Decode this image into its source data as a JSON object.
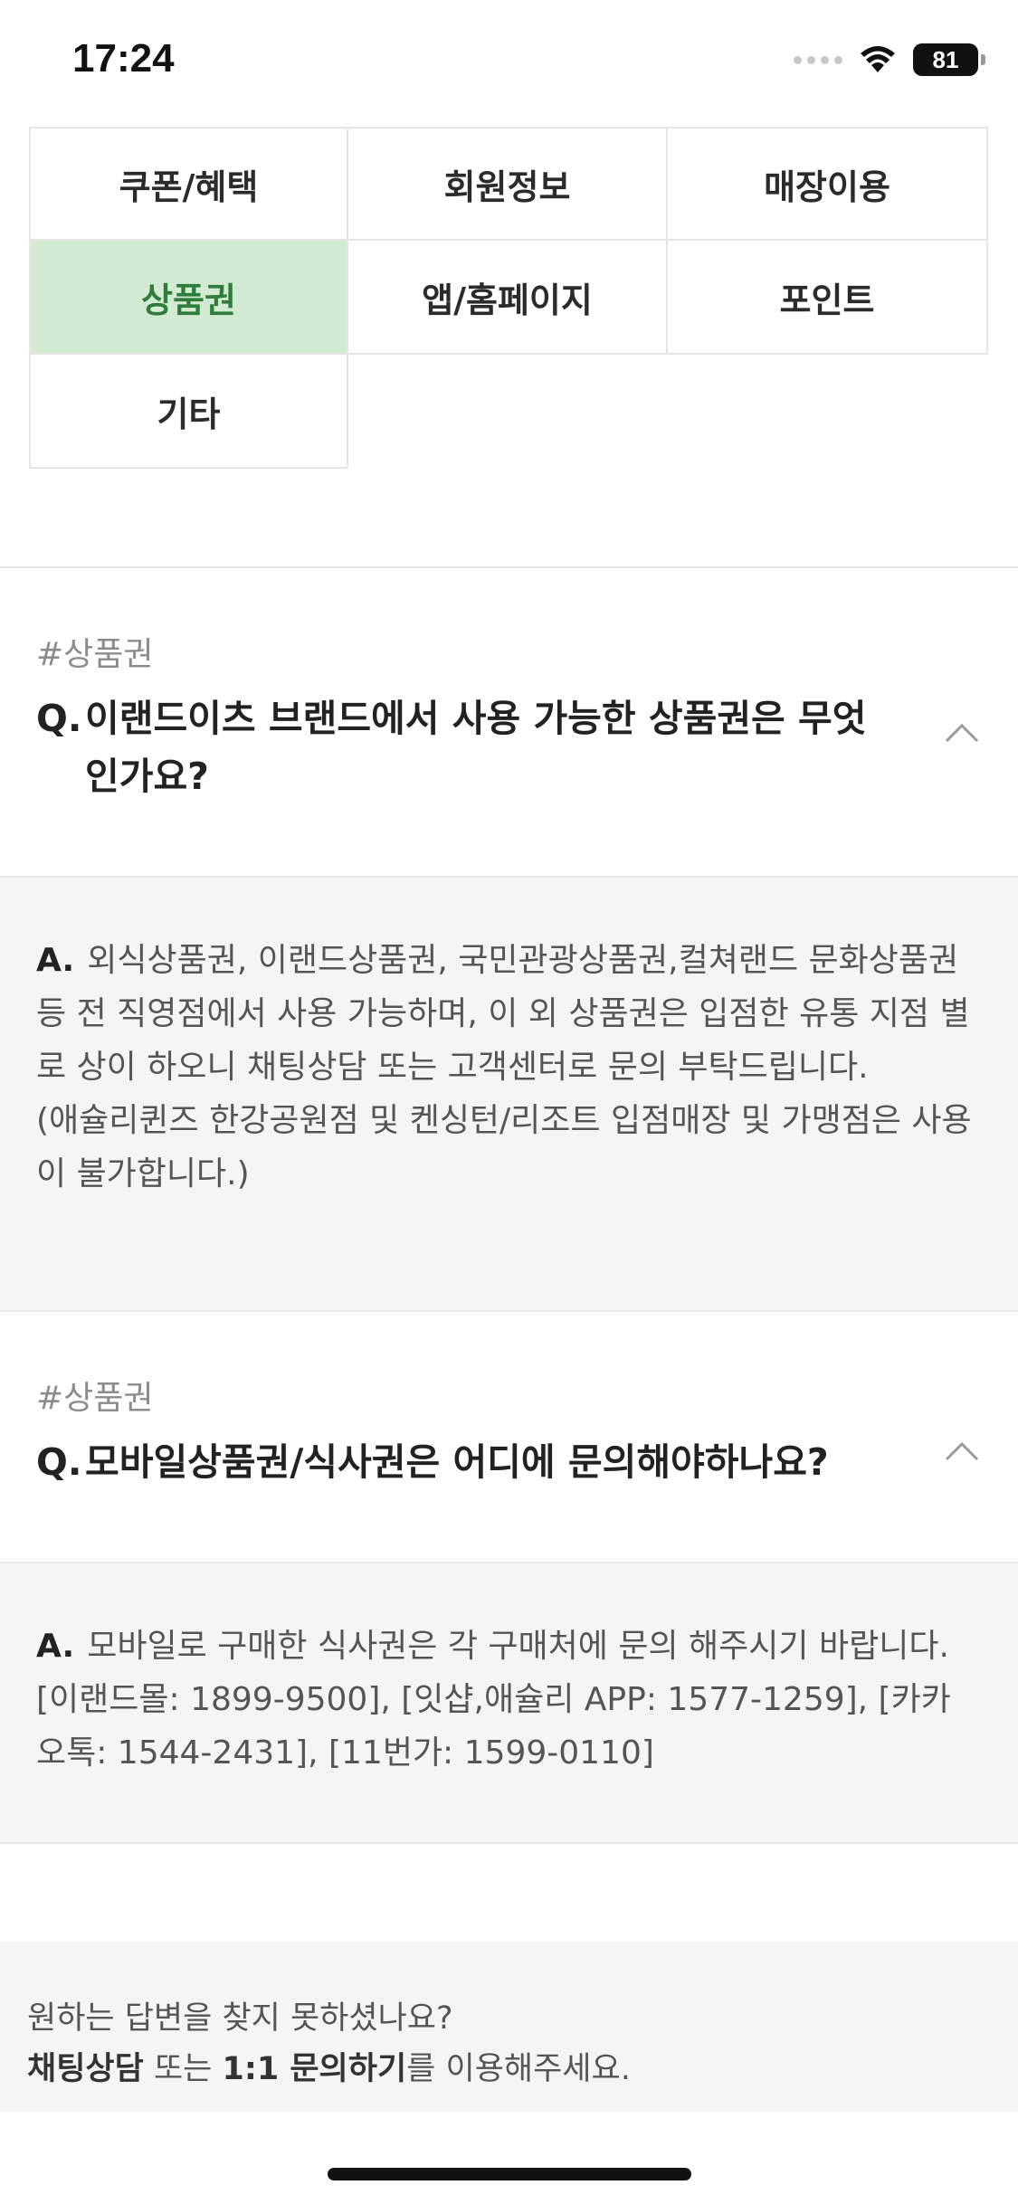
{
  "status_bar": {
    "time": "17:24",
    "battery": "81",
    "icons": [
      "signal-icon",
      "wifi-icon",
      "battery-icon"
    ]
  },
  "categories": [
    {
      "label": "쿠폰/혜택",
      "active": false
    },
    {
      "label": "회원정보",
      "active": false
    },
    {
      "label": "매장이용",
      "active": false
    },
    {
      "label": "상품권",
      "active": true
    },
    {
      "label": "앱/홈페이지",
      "active": false
    },
    {
      "label": "포인트",
      "active": false
    },
    {
      "label": "기타",
      "active": false
    }
  ],
  "faqs": [
    {
      "tag": "#상품권",
      "q_mark": "Q.",
      "question": "이랜드이츠 브랜드에서 사용 가능한 상품권은 무엇인가요?",
      "a_mark": "A.",
      "answer": "외식상품권, 이랜드상품권, 국민관광상품권,컬쳐랜드 문화상품권 등 전 직영점에서 사용 가능하며, 이 외 상품권은 입점한 유통 지점 별로 상이 하오니 채팅상담 또는 고객센터로 문의 부탁드립니다.\n(애슐리퀸즈 한강공원점 및 켄싱턴/리조트 입점매장 및 가맹점은 사용이 불가합니다.)"
    },
    {
      "tag": "#상품권",
      "q_mark": "Q.",
      "question": "모바일상품권/식사권은 어디에 문의해야하나요?",
      "a_mark": "A.",
      "answer": "모바일로 구매한 식사권은 각 구매처에 문의 해주시기 바랍니다. [이랜드몰: 1899-9500], [잇샵,애슐리 APP: 1577-1259], [카카오톡: 1544-2431], [11번가: 1599-0110]"
    }
  ],
  "help": {
    "line1": "원하는 답변을 찾지 못하셨나요?",
    "chat_label": "채팅상담",
    "or_text": " 또는 ",
    "inquiry_label": "1:1 문의하기",
    "suffix": "를 이용해주세요."
  },
  "colors": {
    "active_bg": "#d3ebd3",
    "active_text": "#2f7d3b",
    "answer_bg": "#f5f5f5"
  }
}
